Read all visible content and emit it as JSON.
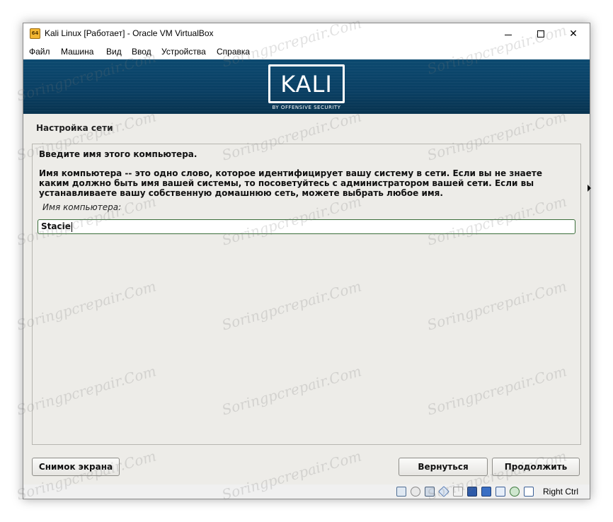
{
  "window": {
    "title": "Kali Linux [Работает] - Oracle VM VirtualBox",
    "app_icon_text": "64",
    "controls": {
      "minimize": "minimize",
      "maximize": "maximize",
      "close": "✕"
    }
  },
  "menu": [
    "Файл",
    "Машина",
    "Вид",
    "Ввод",
    "Устройства",
    "Справка"
  ],
  "banner": {
    "logo_text": "KALI",
    "tagline": "BY OFFENSIVE SECURITY",
    "color": "#0b4266"
  },
  "installer": {
    "section_title": "Настройка сети",
    "heading": "Введите имя этого компьютера.",
    "description": "Имя компьютера -- это одно слово, которое идентифицирует вашу систему в сети. Если вы не знаете каким должно быть имя вашей системы, то посоветуйтесь с администратором вашей сети. Если вы устанавливаете вашу собственную домашнюю сеть, можете выбрать любое имя.",
    "field_label": "Имя компьютера:",
    "hostname_value": "Stacie",
    "buttons": {
      "screenshot": "Снимок экрана",
      "back": "Вернуться",
      "continue": "Продолжить"
    },
    "background_color": "#edece8"
  },
  "statusbar": {
    "icons": [
      "hard-disk-icon",
      "optical-drive-icon",
      "network-icon",
      "usb-icon",
      "shared-folders-icon",
      "display-icon",
      "screen-recording-icon",
      "cpu-icon",
      "mouse-integration-icon",
      "keyboard-icon"
    ],
    "host_key": "Right Ctrl"
  },
  "watermark": "Soringpcrepair.Com"
}
